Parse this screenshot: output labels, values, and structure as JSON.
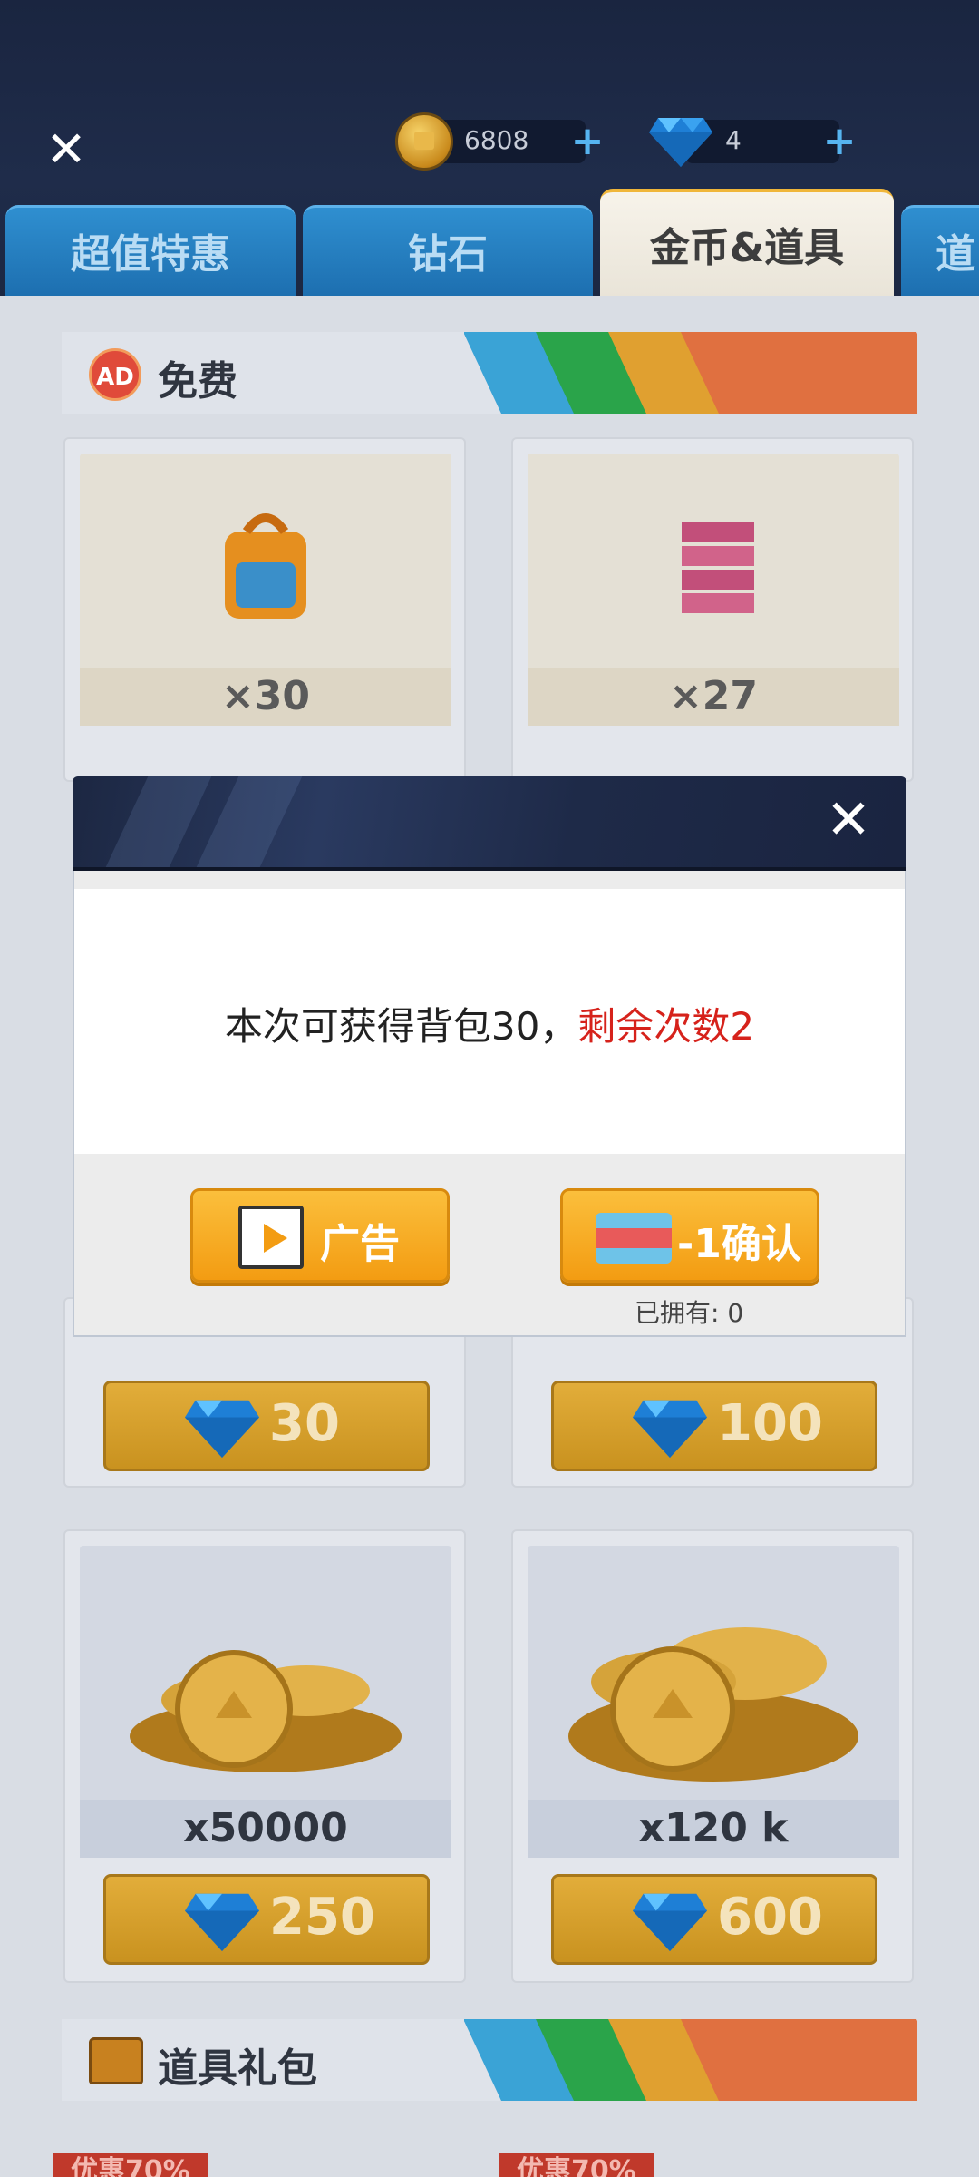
{
  "header": {
    "coins": "6808",
    "gems": "4"
  },
  "tabs": [
    {
      "label": "超值特惠"
    },
    {
      "label": "钻石"
    },
    {
      "label": "金币&道具"
    },
    {
      "label": "道"
    }
  ],
  "sections": {
    "free": {
      "title": "免费",
      "badge": "AD"
    },
    "props_pack": {
      "title": "道具礼包"
    }
  },
  "free_items": [
    {
      "qty": "×30",
      "icon": "backpack-icon"
    },
    {
      "qty": "×27",
      "icon": "bricks-icon"
    }
  ],
  "gem_prices": [
    "30",
    "100"
  ],
  "coin_items": [
    {
      "qty": "x50000",
      "price": "250"
    },
    {
      "qty": "x120 k",
      "price": "600"
    }
  ],
  "discount_badges": [
    "优惠70%",
    "优惠70%"
  ],
  "modal": {
    "message_main": "本次可获得背包30，",
    "message_red": "剩余次数2",
    "ad_button": "广告",
    "confirm_button": "-1确认",
    "owned": "已拥有: 0"
  },
  "colors": {
    "accent": "#f39c12",
    "red": "#d6221b",
    "tab_blue": "#2f8fd0"
  }
}
